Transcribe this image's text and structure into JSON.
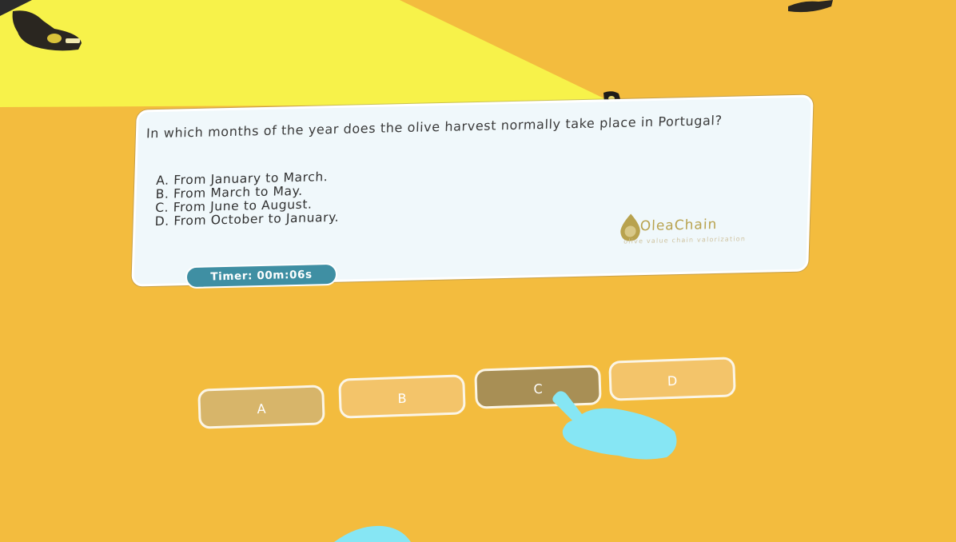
{
  "question": {
    "text": "In which months of the year does the olive harvest normally take place in Portugal?",
    "options": [
      "A. From January to March.",
      "B. From March to May.",
      "C. From June to August.",
      "D. From October to January."
    ]
  },
  "brand": {
    "name": "OleaChain",
    "tagline": "olive value chain valorization"
  },
  "timer": {
    "label": "Timer: 00m:06s"
  },
  "answers": [
    {
      "label": "A",
      "selected": false
    },
    {
      "label": "B",
      "selected": false
    },
    {
      "label": "C",
      "selected": true
    },
    {
      "label": "D",
      "selected": false
    }
  ],
  "colors": {
    "wall": "#F3BC3E",
    "ceiling": "#F7F24A",
    "panel": "#F0F8FB",
    "timer": "#3F8FA3",
    "hand": "#86E6F4",
    "brand": "#B8A24E"
  }
}
